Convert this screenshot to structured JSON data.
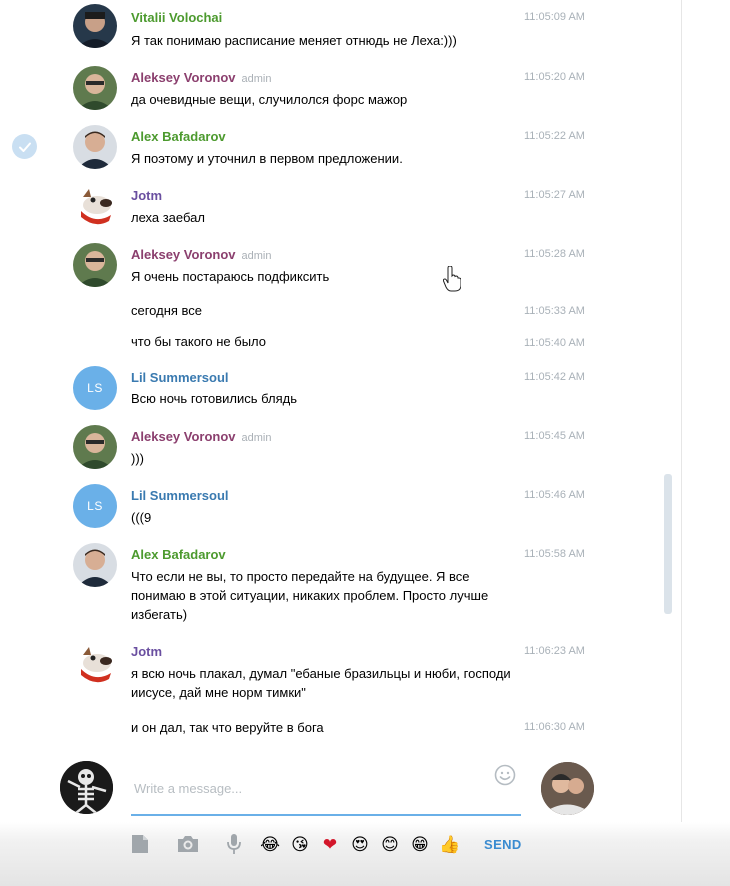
{
  "messages": [
    {
      "name": "Vitalii Volochai",
      "role": "",
      "time": "11:05:09 AM",
      "text": "Я так понимаю расписание меняет отнюдь не Леха:)))"
    },
    {
      "name": "Aleksey Voronov",
      "role": "admin",
      "time": "11:05:20 AM",
      "text": "да очевидные вещи, случилолся форс мажор"
    },
    {
      "name": "Alex Bafadarov",
      "role": "",
      "time": "11:05:22 AM",
      "text": "Я поэтому и уточнил в первом предложении."
    },
    {
      "name": "Jotm",
      "role": "",
      "time": "11:05:27 AM",
      "text": "леха заебал"
    },
    {
      "name": "Aleksey Voronov",
      "role": "admin",
      "time": "11:05:28 AM",
      "text": "Я очень постараюсь подфиксить"
    },
    {
      "name": "",
      "role": "",
      "time": "11:05:33 AM",
      "text": "сегодня все"
    },
    {
      "name": "",
      "role": "",
      "time": "11:05:40 AM",
      "text": "что бы такого не было"
    },
    {
      "name": "Lil Summersoul",
      "role": "",
      "time": "11:05:42 AM",
      "text": "Всю ночь готовились блядь",
      "initials": "LS"
    },
    {
      "name": "Aleksey Voronov",
      "role": "admin",
      "time": "11:05:45 AM",
      "text": ")))"
    },
    {
      "name": "Lil Summersoul",
      "role": "",
      "time": "11:05:46 AM",
      "text": "(((9",
      "initials": "LS"
    },
    {
      "name": "Alex Bafadarov",
      "role": "",
      "time": "11:05:58 AM",
      "text": "Что если не вы, то просто передайте на будущее. Я все понимаю в этой ситуации, никаких проблем. Просто лучше избегать)"
    },
    {
      "name": "Jotm",
      "role": "",
      "time": "11:06:23 AM",
      "text": "я всю ночь плакал, думал \"ебаные бразильцы и нюби, господи иисусе, дай мне норм тимки\""
    },
    {
      "name": "",
      "role": "",
      "time": "11:06:30 AM",
      "text": "и он дал, так что веруйте в бога"
    }
  ],
  "composer": {
    "placeholder": "Write a message...",
    "send_label": "SEND",
    "emojis": [
      "😂",
      "😘",
      "❤",
      "😍",
      "😊",
      "😁",
      "👍"
    ]
  },
  "icons": {
    "attach": "document-icon",
    "photo": "camera-icon",
    "voice": "microphone-icon",
    "smile": "smile-icon",
    "selected": "checkmark-icon"
  },
  "colors": {
    "accent": "#6ab0e8",
    "send": "#3a8bd0",
    "name_green": "#4c9a2e",
    "name_purple": "#8b3f6e",
    "name_violet": "#6a4fa0",
    "name_blue": "#3a7ab0"
  }
}
